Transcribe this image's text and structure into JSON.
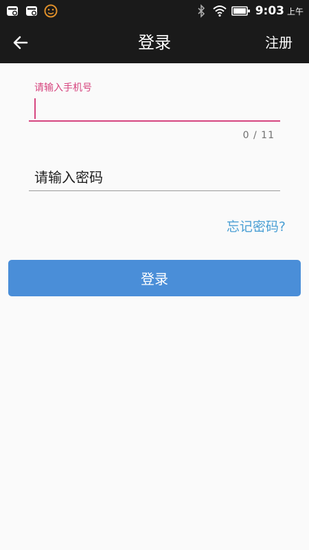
{
  "status_bar": {
    "time": "9:03",
    "ampm": "上午",
    "left_icons": [
      "notification-icon",
      "notification-icon",
      "smiley-icon"
    ],
    "right_icons": [
      "bluetooth-icon",
      "wifi-icon",
      "battery-icon"
    ]
  },
  "app_bar": {
    "title": "登录",
    "back_icon": "arrow-left-icon",
    "register_label": "注册"
  },
  "form": {
    "phone": {
      "label": "请输入手机号",
      "value": "",
      "counter": "0 / 11"
    },
    "password": {
      "placeholder": "请输入密码",
      "value": ""
    },
    "forgot_label": "忘记密码?",
    "login_label": "登录"
  },
  "colors": {
    "app_bar_bg": "#1a1a1a",
    "accent_pink": "#d6457f",
    "link_blue": "#4a9fd4",
    "button_blue": "#4a8ed8",
    "background": "#fafafa"
  }
}
